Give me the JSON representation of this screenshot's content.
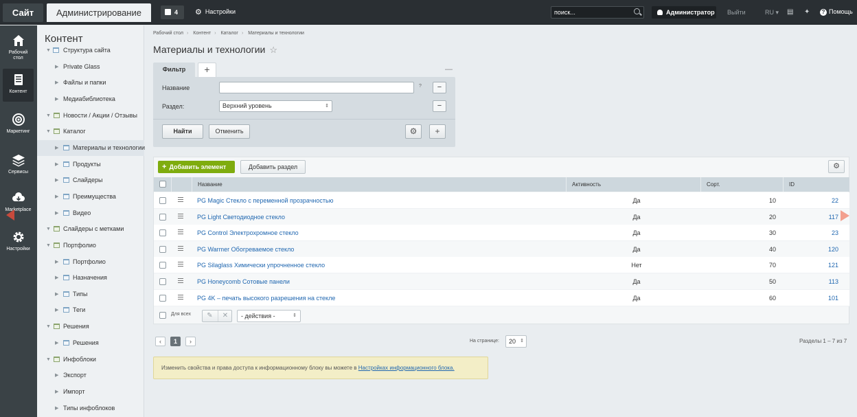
{
  "topbar": {
    "site_tab": "Сайт",
    "admin_tab": "Администрирование",
    "notifications_count": "4",
    "settings_label": "Настройки",
    "search_placeholder": "поиск...",
    "user_label": "Администратор",
    "logout_label": "Выйти",
    "lang_label": "RU",
    "help_label": "Помощь"
  },
  "leftbar": {
    "items": [
      {
        "label_1": "Рабочий",
        "label_2": "стол",
        "icon": "home-icon"
      },
      {
        "label_1": "Контент",
        "label_2": "",
        "icon": "document-icon"
      },
      {
        "label_1": "Маркетинг",
        "label_2": "",
        "icon": "target-icon"
      },
      {
        "label_1": "Сервисы",
        "label_2": "",
        "icon": "layers-icon"
      },
      {
        "label_1": "Marketplace",
        "label_2": "",
        "icon": "cloud-download-icon"
      },
      {
        "label_1": "Настройки",
        "label_2": "",
        "icon": "gear-icon"
      }
    ]
  },
  "tree": {
    "title": "Контент",
    "items": [
      {
        "label": "Структура сайта"
      },
      {
        "label": "Private Glass"
      },
      {
        "label": "Файлы и папки"
      },
      {
        "label": "Медиабиблиотека"
      },
      {
        "label": "Новости / Акции / Отзывы"
      },
      {
        "label": "Каталог"
      },
      {
        "label": "Материалы и технологии"
      },
      {
        "label": "Продукты"
      },
      {
        "label": "Слайдеры"
      },
      {
        "label": "Преимущества"
      },
      {
        "label": "Видео"
      },
      {
        "label": "Слайдеры с метками"
      },
      {
        "label": "Портфолио"
      },
      {
        "label": "Портфолио"
      },
      {
        "label": "Назначения"
      },
      {
        "label": "Типы"
      },
      {
        "label": "Теги"
      },
      {
        "label": "Решения"
      },
      {
        "label": "Решения"
      },
      {
        "label": "Инфоблоки"
      },
      {
        "label": "Экспорт"
      },
      {
        "label": "Импорт"
      },
      {
        "label": "Типы инфоблоков"
      }
    ]
  },
  "breadcrumbs": [
    "Рабочий стол",
    "Контент",
    "Каталог",
    "Материалы и технологии"
  ],
  "page_title": "Материалы и технологии",
  "filter": {
    "tab_label": "Фильтр",
    "add_tab": "+",
    "collapse": "—",
    "name_label": "Название",
    "name_value": "",
    "help_mark": "?",
    "section_label": "Раздел:",
    "section_value": "Верхний уровень",
    "minus": "−",
    "find_button": "Найти",
    "cancel_button": "Отменить"
  },
  "grid": {
    "add_element_button": "Добавить элемент",
    "add_section_button": "Добавить раздел",
    "columns": {
      "name": "Название",
      "active": "Активность",
      "sort": "Сорт.",
      "id": "ID"
    },
    "rows": [
      {
        "name": "PG Magic Стекло с переменной прозрачностью",
        "active": "Да",
        "sort": "10",
        "id": "22"
      },
      {
        "name": "PG Light Светодиодное стекло",
        "active": "Да",
        "sort": "20",
        "id": "117"
      },
      {
        "name": "PG Control Электрохромное стекло",
        "active": "Да",
        "sort": "30",
        "id": "23"
      },
      {
        "name": "PG Warmer Обогреваемое стекло",
        "active": "Да",
        "sort": "40",
        "id": "120"
      },
      {
        "name": "PG Silaglass Химически упрочненное стекло",
        "active": "Нет",
        "sort": "70",
        "id": "121"
      },
      {
        "name": "PG Honeycomb Сотовые панели",
        "active": "Да",
        "sort": "50",
        "id": "113"
      },
      {
        "name": "PG 4K – печать высокого разрешения на стекле",
        "active": "Да",
        "sort": "60",
        "id": "101"
      }
    ],
    "for_all_label": "Для всех",
    "actions_select": "- действия -"
  },
  "pagination": {
    "current_page": "1",
    "per_page_label": "На странице:",
    "per_page_value": "20",
    "range_label": "Разделы 1 – 7 из 7"
  },
  "notice": {
    "text": "Изменить свойства и права доступа к информационному блоку вы можете в",
    "link": "Настройках информационного блока."
  },
  "colors": {
    "accent_green": "#7fac0e",
    "link_blue": "#2067b0",
    "topbar": "#2a2f33"
  }
}
